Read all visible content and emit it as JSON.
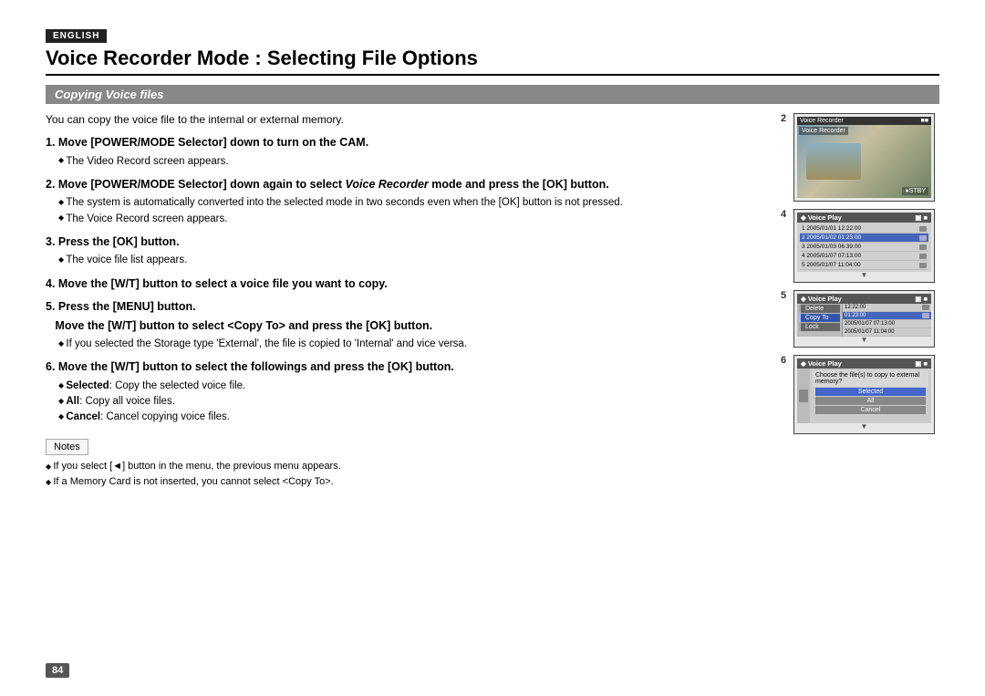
{
  "badge": {
    "label": "ENGLISH"
  },
  "title": "Voice Recorder Mode : Selecting File Options",
  "section": {
    "heading": "Copying Voice files"
  },
  "intro": "You can copy the voice file to the internal or external memory.",
  "steps": [
    {
      "number": "1",
      "title": "Move [POWER/MODE Selector] down to turn on the CAM.",
      "bullets": [
        "The Video Record screen appears."
      ]
    },
    {
      "number": "2",
      "title": "Move [POWER/MODE Selector] down again to select Voice Recorder mode and press the [OK] button.",
      "title_italic": "Voice Recorder",
      "bullets": [
        "The system is automatically converted into the selected mode in two seconds even when the [OK] button is not pressed.",
        "The Voice Record screen appears."
      ]
    },
    {
      "number": "3",
      "title": "Press the [OK] button.",
      "bullets": [
        "The voice file list appears."
      ]
    },
    {
      "number": "4",
      "title": "Move the [W/T] button to select a voice file you want to copy.",
      "bullets": []
    },
    {
      "number": "5",
      "title": "Press the [MENU] button.",
      "subtitle": "Move the [W/T] button to select <Copy To> and press the [OK] button.",
      "bullets": [
        "If you selected the Storage type 'External', the file is copied to 'Internal' and vice versa."
      ]
    },
    {
      "number": "6",
      "title": "Move the [W/T] button to select the followings and press the [OK] button.",
      "bullets": [
        "Selected: Copy the selected voice file.",
        "All: Copy all voice files.",
        "Cancel: Cancel copying voice files."
      ]
    }
  ],
  "notes": {
    "label": "Notes",
    "items": [
      "If you select [◄] button in the menu, the previous menu appears.",
      "If a Memory Card is not inserted, you cannot select <Copy To>."
    ]
  },
  "page_number": "84",
  "screens": [
    {
      "number": "2",
      "type": "camera",
      "title": "Voice Recorder",
      "overlay_top": "Voice Recorder",
      "stby": "●STBY"
    },
    {
      "number": "4",
      "type": "filelist",
      "title": "Voice Play",
      "files": [
        {
          "date": "2005/01/01",
          "time": "12:22:00",
          "selected": false
        },
        {
          "date": "2005/01/02",
          "time": "01:23:00",
          "selected": true
        },
        {
          "date": "2005/01/03",
          "time": "06:39:00",
          "selected": false
        },
        {
          "date": "2005/01/07",
          "time": "07:13:00",
          "selected": false
        },
        {
          "date": "2005/01/07",
          "time": "11:04:00",
          "selected": false
        }
      ]
    },
    {
      "number": "5",
      "type": "menu",
      "title": "Voice Play",
      "menu_items": [
        {
          "label": "Delete",
          "active": false
        },
        {
          "label": "Copy To",
          "active": true
        },
        {
          "label": "Lock",
          "active": false
        }
      ],
      "files": [
        {
          "date": "",
          "time": "12:22:00",
          "selected": false
        },
        {
          "date": "",
          "time": "01:23:00",
          "selected": true
        },
        {
          "date": "2005/01/07",
          "time": "07:13:00",
          "selected": false
        },
        {
          "date": "2005/01/07",
          "time": "11:04:00",
          "selected": false
        }
      ]
    },
    {
      "number": "6",
      "type": "copy",
      "title": "Voice Play",
      "prompt": "Choose the file(s) to copy to external memory?",
      "buttons": [
        {
          "label": "Selected",
          "primary": true
        },
        {
          "label": "All",
          "primary": false
        },
        {
          "label": "Cancel",
          "primary": false
        }
      ]
    }
  ]
}
